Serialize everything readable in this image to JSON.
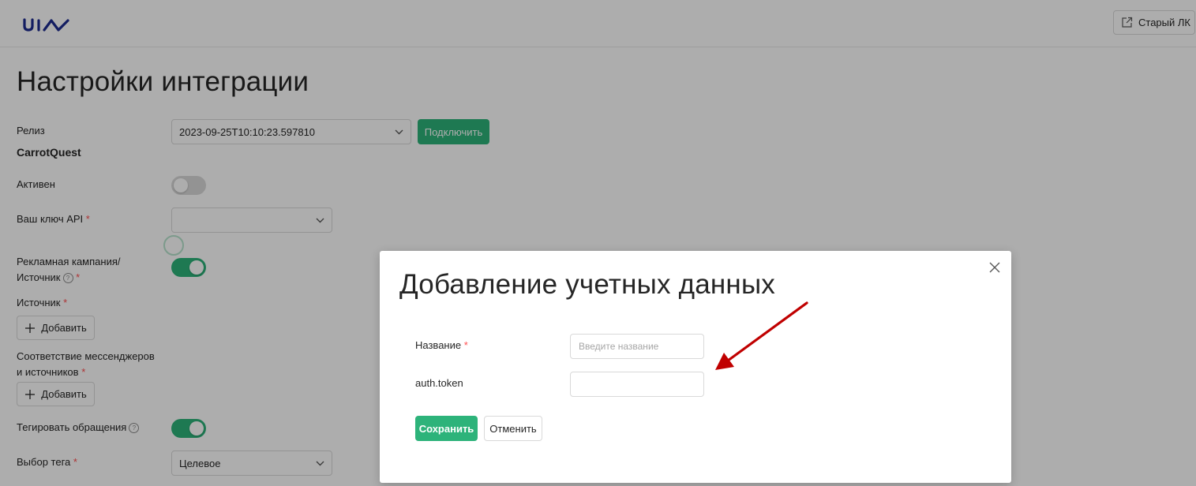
{
  "header": {
    "logo_text": "uis",
    "old_lk_label": "Старый ЛК"
  },
  "page": {
    "title": "Настройки интеграции"
  },
  "form": {
    "release_label": "Релиз",
    "release_value": "2023-09-25T10:10:23.597810",
    "connect_label": "Подключить",
    "section_title": "CarrotQuest",
    "active_label": "Активен",
    "active_on": false,
    "api_key_label": "Ваш ключ API",
    "campaign_label_line1": "Рекламная кампания/",
    "campaign_label_line2": "Источник",
    "campaign_on": true,
    "source_label": "Источник",
    "add_label": "Добавить",
    "mapping_label_line1": "Соответствие мессенджеров",
    "mapping_label_line2": "и источников",
    "tag_requests_label": "Тегировать обращения",
    "tag_requests_on": true,
    "tag_choice_label": "Выбор тега",
    "tag_choice_value": "Целевое",
    "required_mark": "*",
    "help_glyph": "?"
  },
  "modal": {
    "title": "Добавление учетных данных",
    "name_label": "Название",
    "name_placeholder": "Введите название",
    "name_value": "",
    "token_label": "auth.token",
    "token_value": "",
    "save_label": "Сохранить",
    "cancel_label": "Отменить"
  },
  "colors": {
    "accent": "#2db37a",
    "required": "#ff4d4f",
    "annotation_arrow": "#c00000",
    "logo": "#1d2b8f"
  },
  "icons": [
    "logo",
    "external-link-icon",
    "chevron-down-icon",
    "plus-icon",
    "help-icon",
    "close-icon",
    "annotation-arrow"
  ]
}
